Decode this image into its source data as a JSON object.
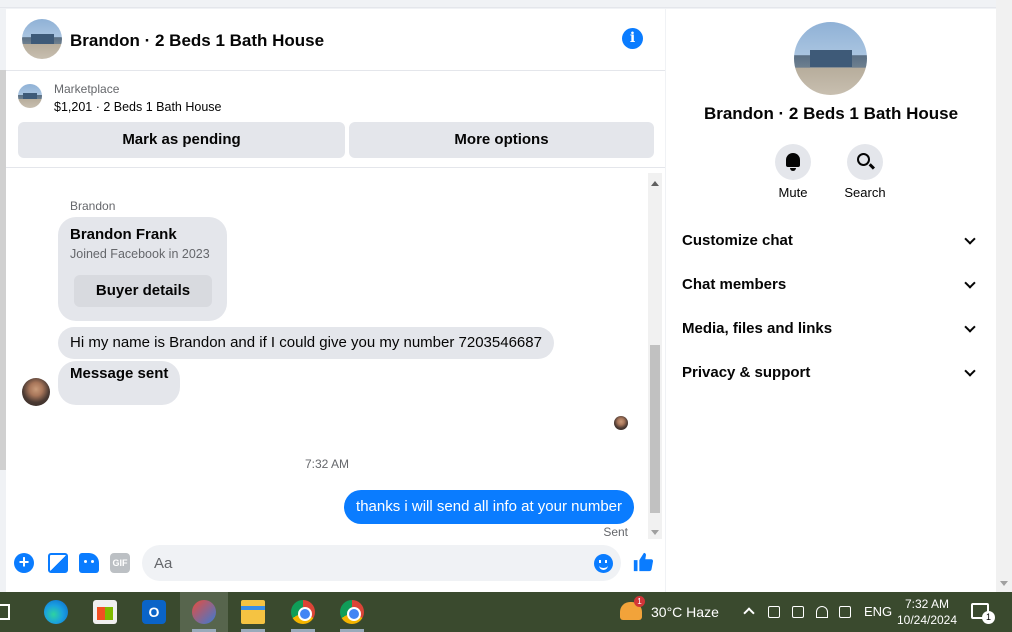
{
  "header": {
    "title": "Brandon · 2 Beds 1 Bath House"
  },
  "marketplace": {
    "label": "Marketplace",
    "listing": "$1,201 · 2 Beds 1 Bath House",
    "mark_pending": "Mark as pending",
    "more_options": "More options"
  },
  "messages": {
    "sender_name": "Brandon",
    "card": {
      "name": "Brandon Frank",
      "subtitle": "Joined Facebook in 2023",
      "button": "Buyer details"
    },
    "incoming": [
      "Hi my name is Brandon  and if I could give you my number 7203546687",
      "Message sent"
    ],
    "timestamp": "7:32 AM",
    "outgoing": "thanks i will send all info at your number",
    "status": "Sent"
  },
  "composer": {
    "placeholder": "Aa",
    "gif_label": "GIF"
  },
  "info_panel": {
    "title": "Brandon · 2 Beds 1 Bath House",
    "actions": [
      "Mute",
      "Search"
    ],
    "sections": [
      "Customize chat",
      "Chat members",
      "Media, files and links",
      "Privacy & support"
    ]
  },
  "taskbar": {
    "outlook_letter": "O",
    "weather_badge": "1",
    "weather": "30°C  Haze",
    "language": "ENG",
    "time": "7:32 AM",
    "date": "10/24/2024",
    "notification_count": "1"
  },
  "colors": {
    "messenger_blue": "#0a7cff",
    "bubble_gray": "#e4e6eb",
    "taskbar": "#3a4a2e"
  }
}
